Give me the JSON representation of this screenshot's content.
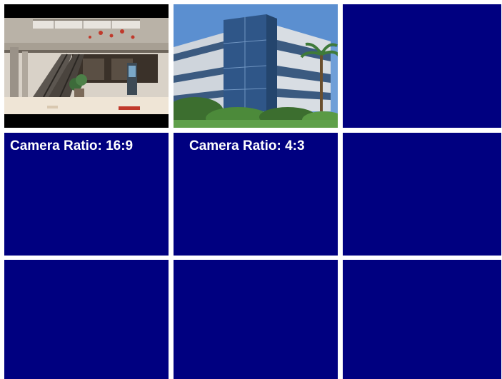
{
  "grid": {
    "tile_color": "#000080",
    "tiles": [
      {
        "id": "cam-1",
        "content": "mall-interior-feed",
        "letterbox_color": "#000000"
      },
      {
        "id": "cam-2",
        "content": "office-building-feed"
      },
      {
        "id": "cam-3",
        "content": "empty"
      },
      {
        "id": "cam-4",
        "content": "empty",
        "label": "Camera Ratio: 16:9"
      },
      {
        "id": "cam-5",
        "content": "empty",
        "label": "Camera Ratio: 4:3"
      },
      {
        "id": "cam-6",
        "content": "empty"
      },
      {
        "id": "cam-7",
        "content": "empty"
      },
      {
        "id": "cam-8",
        "content": "empty"
      },
      {
        "id": "cam-9",
        "content": "empty"
      }
    ]
  }
}
